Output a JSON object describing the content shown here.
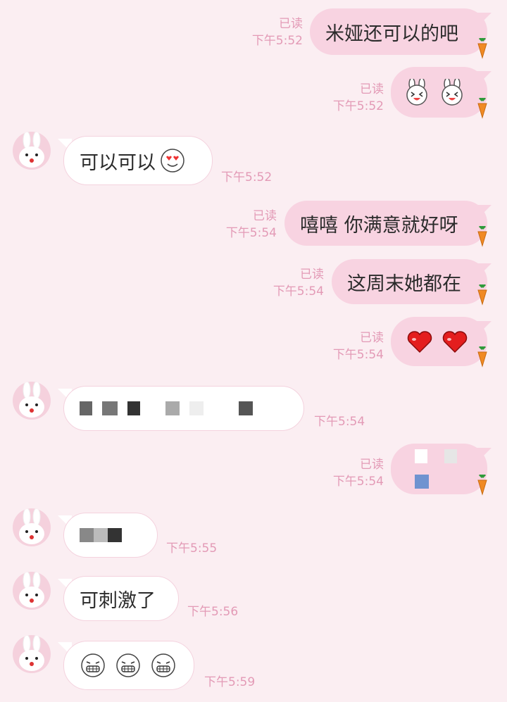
{
  "messages": [
    {
      "side": "out",
      "text": "米娅还可以的吧",
      "read": "已读",
      "time": "下午5:52"
    },
    {
      "side": "out",
      "stickers": [
        "laughing-bunny",
        "laughing-bunny"
      ],
      "read": "已读",
      "time": "下午5:52"
    },
    {
      "side": "in",
      "text": "可以可以",
      "emoji": "heart-eyes",
      "time": "下午5:52"
    },
    {
      "side": "out",
      "text": "嘻嘻 你满意就好呀",
      "read": "已读",
      "time": "下午5:54"
    },
    {
      "side": "out",
      "text": "这周末她都在",
      "read": "已读",
      "time": "下午5:54"
    },
    {
      "side": "out",
      "stickers": [
        "red-heart",
        "red-heart"
      ],
      "read": "已读",
      "time": "下午5:54"
    },
    {
      "side": "in",
      "redacted": true,
      "time": "下午5:54"
    },
    {
      "side": "out",
      "redacted": true,
      "read": "已读",
      "time": "下午5:54"
    },
    {
      "side": "in",
      "redacted": true,
      "time": "下午5:55"
    },
    {
      "side": "in",
      "text": "可刺激了",
      "time": "下午5:56"
    },
    {
      "side": "in",
      "stickers": [
        "grimace",
        "grimace",
        "grimace"
      ],
      "time": "下午5:59"
    }
  ]
}
